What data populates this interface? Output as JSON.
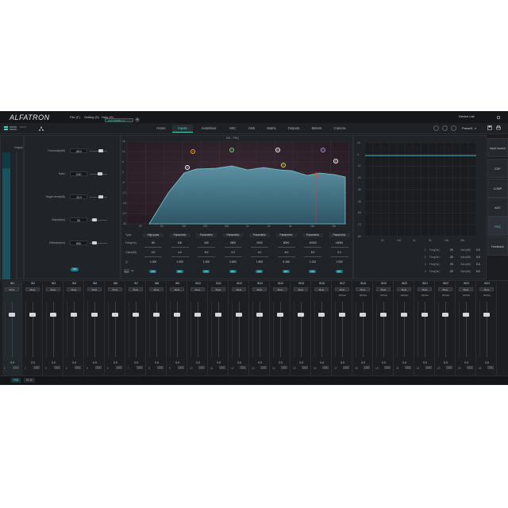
{
  "app": {
    "logo": "ALFATRON",
    "window_title": "Device List",
    "device_chip": "ALF-DSP88 1.0"
  },
  "menus": [
    "File (F)",
    "Setting (S)",
    "Help (H)"
  ],
  "tabs": [
    {
      "label": "Home",
      "active": false
    },
    {
      "label": "Inputs",
      "active": true
    },
    {
      "label": "AutoMixer",
      "active": false
    },
    {
      "label": "AEC",
      "active": false
    },
    {
      "label": "ANS",
      "active": false
    },
    {
      "label": "Matrix",
      "active": false
    },
    {
      "label": "Outputs",
      "active": false
    },
    {
      "label": "Meters",
      "active": false
    },
    {
      "label": "Camera",
      "active": false
    }
  ],
  "preset": "Preset1",
  "input_meter_label": "Output",
  "params": [
    {
      "label": "Threshold(dB)",
      "value": "-48.0",
      "level": 0.62
    },
    {
      "label": "Ratio",
      "value": "3.50",
      "level": 0.58
    },
    {
      "label": "Target level(dB)",
      "value": "-15.0",
      "level": 0.62
    },
    {
      "label": "Attack(ms)",
      "value": "50",
      "level": 0.25
    },
    {
      "label": "Release(ms)",
      "value": "500",
      "level": 0.25
    }
  ],
  "dynamics_on_label": "ON",
  "eq": {
    "header": "IN1 · PEQ",
    "row_labels": {
      "type": "Type",
      "freq": "Freq(Hz)",
      "gain": "Gain(dB)",
      "q": "Q"
    },
    "bypass_label": "Byp",
    "all_label": "All",
    "bands": [
      {
        "type": "High pass",
        "freq": "80",
        "gain": "0.0",
        "q": "1.000",
        "on": "ON"
      },
      {
        "type": "Parametric",
        "freq": "100",
        "gain": "4.0",
        "q": "1.000",
        "on": "ON"
      },
      {
        "type": "Parametric",
        "freq": "400",
        "gain": "5.0",
        "q": "1.000",
        "on": "ON"
      },
      {
        "type": "Parametric",
        "freq": "2500",
        "gain": "2.2",
        "q": "0.800",
        "on": "ON"
      },
      {
        "type": "Parametric",
        "freq": "2000",
        "gain": "4.0",
        "q": "1.893",
        "on": "ON"
      },
      {
        "type": "Parametric",
        "freq": "8000",
        "gain": "-6.0",
        "q": "0.166",
        "on": "ON"
      },
      {
        "type": "Parametric",
        "freq": "10000",
        "gain": "5.0",
        "q": "1.212",
        "on": "ON"
      },
      {
        "type": "Parametric",
        "freq": "16000",
        "gain": "0.0",
        "q": "1.000",
        "on": "ON"
      }
    ],
    "markers": [
      "1",
      "2",
      "3",
      "4",
      "5",
      "6",
      "7",
      "8"
    ],
    "y_ticks": [
      "18",
      "12",
      "6",
      "0",
      "-6",
      "-12",
      "-18",
      "-24",
      "-30"
    ],
    "x_ticks": [
      "20",
      "50",
      "100",
      "200",
      "500",
      "1k",
      "2k",
      "5k",
      "10k",
      "20k"
    ]
  },
  "agc_graph": {
    "y_ticks": [
      "18",
      "0",
      "-12",
      "-24",
      "-36",
      "-48",
      "-60",
      "-72",
      "-80"
    ],
    "x_ticks": [
      "20",
      "100",
      "1k",
      "5k",
      "10k",
      "20k"
    ]
  },
  "side_buttons": [
    {
      "label": "Input source",
      "active": false
    },
    {
      "label": "EXP",
      "active": false
    },
    {
      "label": "COMP",
      "active": false
    },
    {
      "label": "AGC",
      "active": false
    },
    {
      "label": "PEQ",
      "active": true
    },
    {
      "label": "Feedback",
      "active": false
    }
  ],
  "feedback_rows": [
    {
      "n": "1",
      "freq_label": "Freq(Hz)",
      "freq": "20",
      "gain_label": "Gain(dB)",
      "gain": "0.0"
    },
    {
      "n": "2",
      "freq_label": "Freq(Hz)",
      "freq": "20",
      "gain_label": "Gain(dB)",
      "gain": "0.0"
    },
    {
      "n": "3",
      "freq_label": "Freq(Hz)",
      "freq": "20",
      "gain_label": "Gain(dB)",
      "gain": "0.0"
    },
    {
      "n": "4",
      "freq_label": "Freq(Hz)",
      "freq": "20",
      "gain_label": "Gain(dB)",
      "gain": "0.0"
    }
  ],
  "mixer": {
    "mute_label": "Mute",
    "link_label": "Link",
    "phantom_label": "48Volts",
    "channels": [
      {
        "name": "IN1",
        "value": "0.0",
        "num": "1",
        "phantom": false
      },
      {
        "name": "IN2",
        "value": "0.0",
        "num": "2",
        "phantom": false
      },
      {
        "name": "IN3",
        "value": "0.0",
        "num": "3",
        "phantom": false
      },
      {
        "name": "IN4",
        "value": "0.0",
        "num": "4",
        "phantom": false
      },
      {
        "name": "IN5",
        "value": "0.0",
        "num": "5",
        "phantom": false
      },
      {
        "name": "IN6",
        "value": "0.0",
        "num": "6",
        "phantom": false
      },
      {
        "name": "IN7",
        "value": "0.0",
        "num": "7",
        "phantom": false
      },
      {
        "name": "IN8",
        "value": "0.0",
        "num": "8",
        "phantom": false
      },
      {
        "name": "IN9",
        "value": "0.0",
        "num": "9",
        "phantom": false
      },
      {
        "name": "IN10",
        "value": "0.0",
        "num": "10",
        "phantom": false
      },
      {
        "name": "IN11",
        "value": "0.0",
        "num": "11",
        "phantom": false
      },
      {
        "name": "IN12",
        "value": "0.0",
        "num": "12",
        "phantom": false
      },
      {
        "name": "IN13",
        "value": "0.0",
        "num": "13",
        "phantom": false
      },
      {
        "name": "IN14",
        "value": "0.0",
        "num": "14",
        "phantom": false
      },
      {
        "name": "IN15",
        "value": "0.0",
        "num": "15",
        "phantom": false
      },
      {
        "name": "IN16",
        "value": "0.0",
        "num": "16",
        "phantom": false
      },
      {
        "name": "IN17",
        "value": "0.0",
        "num": "17",
        "phantom": true
      },
      {
        "name": "IN18",
        "value": "0.0",
        "num": "18",
        "phantom": true
      },
      {
        "name": "IN19",
        "value": "0.0",
        "num": "19",
        "phantom": true
      },
      {
        "name": "IN20",
        "value": "0.0",
        "num": "20",
        "phantom": true
      },
      {
        "name": "IN21",
        "value": "0.0",
        "num": "21",
        "phantom": true
      },
      {
        "name": "IN22",
        "value": "0.0",
        "num": "22",
        "phantom": true
      },
      {
        "name": "IN23",
        "value": "0.0",
        "num": "23",
        "phantom": true
      },
      {
        "name": "IN24",
        "value": "0.0",
        "num": "24",
        "phantom": true
      }
    ]
  },
  "status": {
    "left_tab": "PAN",
    "right_tab": "IN 16"
  },
  "colors": {
    "accent": "#4fd1c5",
    "bg": "#1b1d21",
    "eq_fill": "#3d6e80",
    "on_btn": "#197a8a"
  }
}
